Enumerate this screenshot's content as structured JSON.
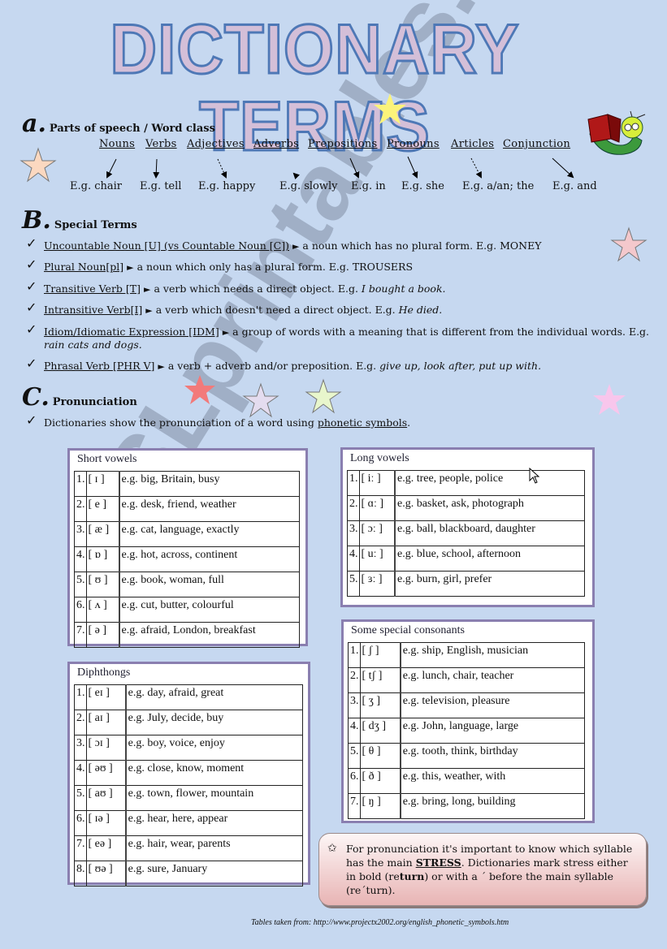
{
  "title": "DICTIONARY TERMS",
  "section_a": {
    "letter": "a.",
    "title": "Parts of speech / Word class",
    "word_classes": [
      {
        "label": "Nouns",
        "example": "E.g. chair"
      },
      {
        "label": "Verbs",
        "example": "E.g. tell"
      },
      {
        "label": "Adjectives",
        "example": "E.g. happy"
      },
      {
        "label": "Adverbs",
        "example": "E.g. slowly"
      },
      {
        "label": "Prepositions",
        "example": "E.g. in"
      },
      {
        "label": "Pronouns",
        "example": "E.g. she"
      },
      {
        "label": "Articles",
        "example": "E.g. a/an; the"
      },
      {
        "label": "Conjunction",
        "example": "E.g. and"
      }
    ]
  },
  "section_b": {
    "letter": "B.",
    "title": "Special Terms",
    "terms": [
      {
        "term": "Uncountable Noun [U] (vs Countable Noun [C])",
        "definition": "a noun which has no plural form. E.g. MONEY"
      },
      {
        "term": "Plural Noun[pl]",
        "definition": "a noun which only has a plural form. E.g. TROUSERS"
      },
      {
        "term": "Transitive Verb [T]",
        "definition": "a verb which needs a direct object. E.g.",
        "example": "I bought a book."
      },
      {
        "term": "Intransitive Verb[I]",
        "definition": "a verb which doesn't need a direct object. E.g.",
        "example": "He died."
      },
      {
        "term": "Idiom/Idiomatic Expression [IDM]",
        "definition": "a group of words with a meaning that is different from the individual words. E.g.",
        "example": "rain cats and dogs."
      },
      {
        "term": "Phrasal Verb [PHR V]",
        "definition": "a verb + adverb and/or preposition. E.g.",
        "example": "give up, look after, put up with."
      }
    ]
  },
  "section_c": {
    "letter": "C.",
    "title": "Pronunciation",
    "intro": "Dictionaries show the pronunciation of a word using",
    "intro_link": "phonetic symbols",
    "intro_end": "."
  },
  "tables": {
    "short_vowels": {
      "title": "Short vowels",
      "rows": [
        {
          "n": "1.",
          "sym": "[ ɪ ]",
          "ex": "e.g. big, Britain, busy"
        },
        {
          "n": "2.",
          "sym": "[ e ]",
          "ex": "e.g. desk, friend, weather"
        },
        {
          "n": "3.",
          "sym": "[ æ ]",
          "ex": "e.g. cat, language, exactly"
        },
        {
          "n": "4.",
          "sym": "[ ɒ ]",
          "ex": "e.g. hot, across, continent"
        },
        {
          "n": "5.",
          "sym": "[ ʊ ]",
          "ex": "e.g. book, woman, full"
        },
        {
          "n": "6.",
          "sym": "[ ʌ ]",
          "ex": "e.g. cut, butter, colourful"
        },
        {
          "n": "7.",
          "sym": "[ ə ]",
          "ex": "e.g. afraid, London, breakfast"
        }
      ]
    },
    "long_vowels": {
      "title": "Long vowels",
      "rows": [
        {
          "n": "1.",
          "sym": "[ iː ]",
          "ex": "e.g. tree, people, police"
        },
        {
          "n": "2.",
          "sym": "[ ɑː ]",
          "ex": "e.g. basket, ask, photograph"
        },
        {
          "n": "3.",
          "sym": "[ ɔː ]",
          "ex": "e.g. ball, blackboard, daughter"
        },
        {
          "n": "4.",
          "sym": "[ uː ]",
          "ex": "e.g. blue, school, afternoon"
        },
        {
          "n": "5.",
          "sym": "[ ɜː ]",
          "ex": "e.g. burn, girl, prefer"
        }
      ]
    },
    "diphthongs": {
      "title": "Diphthongs",
      "rows": [
        {
          "n": "1.",
          "sym": "[ eɪ ]",
          "ex": "e.g. day, afraid, great"
        },
        {
          "n": "2.",
          "sym": "[ aɪ ]",
          "ex": "e.g. July, decide, buy"
        },
        {
          "n": "3.",
          "sym": "[ ɔɪ ]",
          "ex": "e.g. boy, voice, enjoy"
        },
        {
          "n": "4.",
          "sym": "[ əʊ ]",
          "ex": "e.g. close, know, moment"
        },
        {
          "n": "5.",
          "sym": "[ aʊ ]",
          "ex": "e.g. town, flower, mountain"
        },
        {
          "n": "6.",
          "sym": "[ ɪə ]",
          "ex": "e.g. hear, here, appear"
        },
        {
          "n": "7.",
          "sym": "[ eə ]",
          "ex": "e.g. hair, wear, parents"
        },
        {
          "n": "8.",
          "sym": "[ ʊə ]",
          "ex": "e.g. sure, January"
        }
      ]
    },
    "consonants": {
      "title": "Some special consonants",
      "rows": [
        {
          "n": "1.",
          "sym": "[ ʃ ]",
          "ex": "e.g. ship, English, musician"
        },
        {
          "n": "2.",
          "sym": "[ tʃ ]",
          "ex": "e.g. lunch, chair, teacher"
        },
        {
          "n": "3.",
          "sym": "[ ʒ ]",
          "ex": "e.g. television, pleasure"
        },
        {
          "n": "4.",
          "sym": "[ dʒ ]",
          "ex": "e.g. John, language, large"
        },
        {
          "n": "5.",
          "sym": "[ θ ]",
          "ex": "e.g. tooth, think, birthday"
        },
        {
          "n": "6.",
          "sym": "[ ð ]",
          "ex": "e.g. this, weather, with"
        },
        {
          "n": "7.",
          "sym": "[ ŋ ]",
          "ex": "e.g. bring, long, building"
        }
      ]
    }
  },
  "note": {
    "icon": "star-outline-icon",
    "text_1": "For pronunciation it's important to know which syllable has the main",
    "stress_word": "STRESS",
    "text_2": ". Dictionaries mark stress either in bold (re",
    "bold_part": "turn",
    "text_3": ") or with a ˊ before the main syllable (reˊturn)."
  },
  "source": "Tables taken from: http://www.projectx2002.org/english_phonetic_symbols.htm",
  "watermark": "ESLprintables.com",
  "colors": {
    "background": "#c6d8f0",
    "title_fill": "#d4bfd8",
    "title_stroke": "#4e78b6",
    "box_border": "#8a7fb0"
  }
}
